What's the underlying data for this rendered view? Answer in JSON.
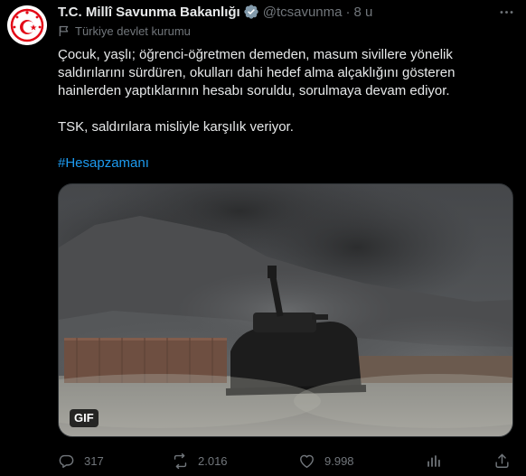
{
  "tweet": {
    "author_name": "T.C. Millî Savunma Bakanlığı",
    "handle": "@tcsavunma",
    "separator": "·",
    "time": "8 u",
    "label": "Türkiye devlet kurumu",
    "paragraphs": [
      "Çocuk, yaşlı; öğrenci-öğretmen demeden, masum sivillere yönelik saldırılarını sürdüren, okulları dahi hedef alma alçaklığını gösteren hainlerden yaptıklarının hesabı soruldu, sorulmaya devam ediyor.",
      "TSK, saldırılara misliyle karşılık veriyor."
    ],
    "hashtag": "#Hesapzamanı",
    "media_badge": "GIF"
  },
  "actions": {
    "replies": "317",
    "retweets": "2.016",
    "likes": "9.998"
  },
  "colors": {
    "background": "#000000",
    "text": "#e7e9ea",
    "muted": "#71767b",
    "link": "#1d9bf0",
    "verified_badge": "#829aab",
    "avatar_red": "#e30a17"
  },
  "icons": {
    "avatar": "ministry-emblem",
    "verified": "verified-badge-icon",
    "more": "more-icon",
    "label": "flag-icon",
    "reply": "reply-icon",
    "retweet": "retweet-icon",
    "like": "like-icon",
    "views": "views-icon",
    "share": "share-icon"
  }
}
